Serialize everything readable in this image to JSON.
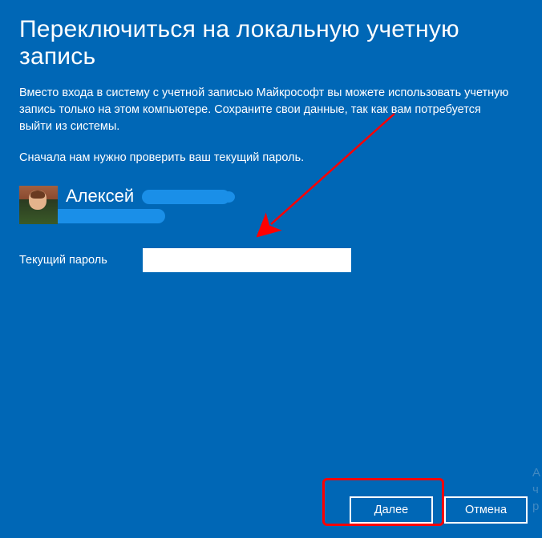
{
  "title": "Переключиться на локальную учетную запись",
  "description": "Вместо входа в систему с учетной записью Майкрософт вы можете использовать учетную запись только на этом компьютере. Сохраните свои данные, так как вам потребуется выйти из системы.",
  "prompt": "Сначала нам нужно проверить ваш текущий пароль.",
  "user": {
    "first_name": "Алексей"
  },
  "password": {
    "label": "Текущий пароль",
    "value": ""
  },
  "buttons": {
    "next": "Далее",
    "cancel": "Отмена"
  }
}
